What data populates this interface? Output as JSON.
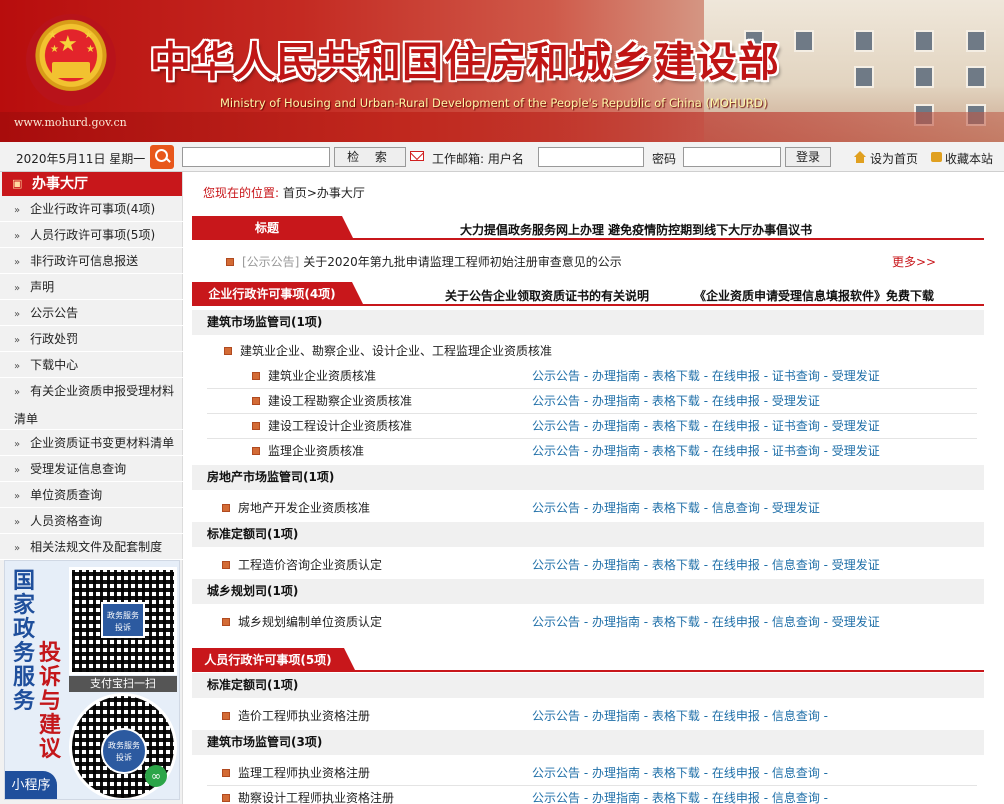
{
  "banner": {
    "site_url": "www.mohurd.gov.cn",
    "title_cn": "中华人民共和国住房和城乡建设部",
    "title_en": "Ministry of Housing and Urban-Rural Development of the People's Republic of China (MOHURD)"
  },
  "toolbar": {
    "date": "2020年5月11日 星期一",
    "search_value": "",
    "search_button": "检 索",
    "mailbox_label": "工作邮箱: 用户名",
    "username_value": "",
    "password_label": "密码",
    "password_value": "",
    "login_button": "登录",
    "set_home": "设为首页",
    "bookmark": "收藏本站"
  },
  "sidebar": {
    "heading": "办事大厅",
    "items": [
      {
        "label": "企业行政许可事项(4项)"
      },
      {
        "label": "人员行政许可事项(5项)"
      },
      {
        "label": "非行政许可信息报送"
      },
      {
        "label": "声明"
      },
      {
        "label": "公示公告"
      },
      {
        "label": "行政处罚"
      },
      {
        "label": "下载中心"
      },
      {
        "label": "有关企业资质申报受理材料清单"
      },
      {
        "label": "企业资质证书变更材料清单"
      },
      {
        "label": "受理发证信息查询"
      },
      {
        "label": "单位资质查询"
      },
      {
        "label": "人员资格查询"
      },
      {
        "label": "相关法规文件及配套制度"
      }
    ],
    "promo": {
      "line1": "国家政务服务",
      "line2": "投诉与建议",
      "badge": "政务服务 投诉",
      "caption": "支付宝扫一扫",
      "mini_tag": "小程序"
    }
  },
  "main": {
    "breadcrumb_label": "您现在的位置:",
    "breadcrumb_path": "首页>办事大厅",
    "tab_title": "标题",
    "headline": "大力提倡政务服务网上办理 避免疫情防控期到线下大厅办事倡议书",
    "notice_tag": "[公示公告]",
    "notice_text": "关于2020年第九批申请监理工程师初始注册审查意见的公示",
    "more": "更多>>",
    "section1": {
      "tab": "企业行政许可事项(4项)",
      "link1": "关于公告企业领取资质证书的有关说明",
      "link2": "《企业资质申请受理信息填报软件》免费下载",
      "groups": [
        {
          "title": "建筑市场监管司(1项)"
        },
        {
          "title": "房地产市场监管司(1项)"
        },
        {
          "title": "标准定额司(1项)"
        },
        {
          "title": "城乡规划司(1项)"
        }
      ],
      "parent_item": "建筑业企业、勘察企业、设计企业、工程监理企业资质核准",
      "rows": [
        {
          "name": "建筑业企业资质核准",
          "links": "公示公告 - 办理指南 - 表格下载 - 在线申报 - 证书查询 - 受理发证"
        },
        {
          "name": "建设工程勘察企业资质核准",
          "links": "公示公告 - 办理指南 - 表格下载 - 在线申报 - 受理发证"
        },
        {
          "name": "建设工程设计企业资质核准",
          "links": "公示公告 - 办理指南 - 表格下载 - 在线申报 - 证书查询 - 受理发证"
        },
        {
          "name": "监理企业资质核准",
          "links": "公示公告 - 办理指南 - 表格下载 - 在线申报 - 证书查询 - 受理发证"
        },
        {
          "name": "房地产开发企业资质核准",
          "links": "公示公告 - 办理指南 - 表格下载 - 信息查询 - 受理发证"
        },
        {
          "name": "工程造价咨询企业资质认定",
          "links": "公示公告 - 办理指南 - 表格下载 - 在线申报 - 信息查询 - 受理发证"
        },
        {
          "name": "城乡规划编制单位资质认定",
          "links": "公示公告 - 办理指南 - 表格下载 - 在线申报 - 信息查询 - 受理发证"
        }
      ]
    },
    "section2": {
      "tab": "人员行政许可事项(5项)",
      "groups": [
        {
          "title": "标准定额司(1项)"
        },
        {
          "title": "建筑市场监管司(3项)"
        }
      ],
      "rows": [
        {
          "name": "造价工程师执业资格注册",
          "links": "公示公告 - 办理指南 - 表格下载 - 在线申报 - 信息查询 -"
        },
        {
          "name": "监理工程师执业资格注册",
          "links": "公示公告 - 办理指南 - 表格下载 - 在线申报 - 信息查询 -"
        },
        {
          "name": "勘察设计工程师执业资格注册",
          "links": "公示公告 - 办理指南 - 表格下载 - 在线申报 - 信息查询 -"
        }
      ]
    }
  }
}
